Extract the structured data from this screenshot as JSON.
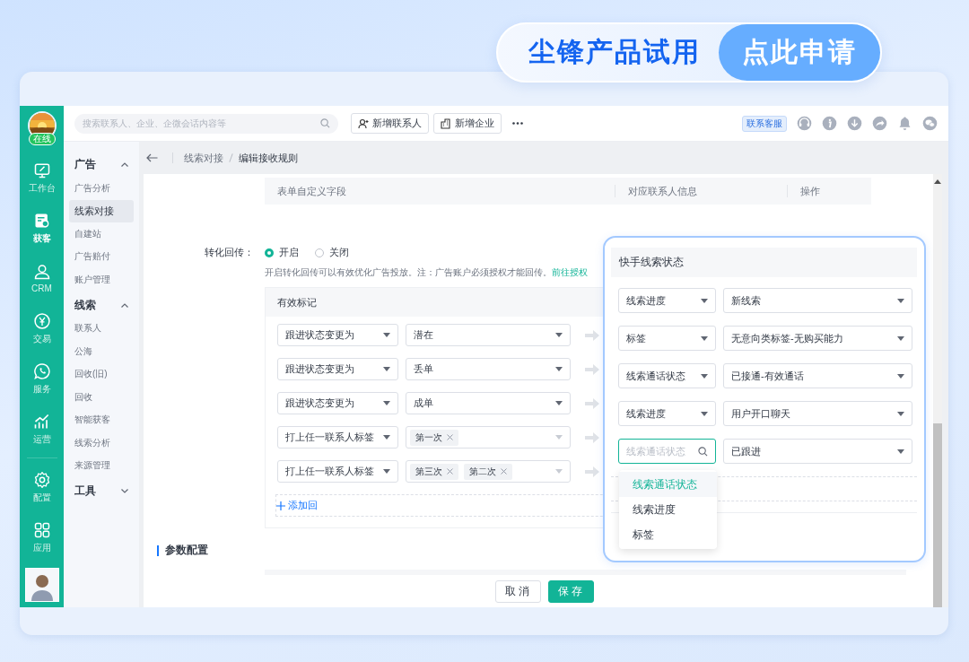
{
  "promo": {
    "title": "尘锋产品试用",
    "button": "点此申请"
  },
  "rail": {
    "status": "在线",
    "items": [
      {
        "label": "工作台",
        "selected": false
      },
      {
        "label": "获客",
        "selected": true
      },
      {
        "label": "CRM",
        "selected": false
      },
      {
        "label": "交易",
        "selected": false
      },
      {
        "label": "服务",
        "selected": false
      },
      {
        "label": "运营",
        "selected": false
      },
      {
        "label": "配置",
        "selected": false
      },
      {
        "label": "应用",
        "selected": false
      }
    ]
  },
  "topbar": {
    "search": {
      "placeholder": "搜索联系人、企业、企微会话内容等"
    },
    "buttons": [
      "新增联系人",
      "新增企业"
    ],
    "support": "联系客服"
  },
  "subnav": {
    "groups": [
      {
        "label": "广告",
        "expanded": true,
        "items": [
          {
            "label": "广告分析",
            "selected": false
          },
          {
            "label": "线索对接",
            "selected": true
          },
          {
            "label": "自建站",
            "selected": false
          },
          {
            "label": "广告赔付",
            "selected": false
          },
          {
            "label": "账户管理",
            "selected": false
          }
        ]
      },
      {
        "label": "线索",
        "expanded": true,
        "items": [
          {
            "label": "联系人",
            "selected": false
          },
          {
            "label": "公海",
            "selected": false
          },
          {
            "label": "回收(旧)",
            "selected": false
          },
          {
            "label": "回收",
            "selected": false
          },
          {
            "label": "智能获客",
            "selected": false
          },
          {
            "label": "线索分析",
            "selected": false
          },
          {
            "label": "来源管理",
            "selected": false
          }
        ]
      },
      {
        "label": "工具",
        "expanded": false
      }
    ]
  },
  "breadcrumb": [
    "线索对接",
    "编辑接收规则"
  ],
  "table": {
    "columns": [
      "表单自定义字段",
      "对应联系人信息",
      "操作"
    ]
  },
  "conversion": {
    "label": "转化回传：",
    "options": [
      {
        "label": "开启",
        "selected": true
      },
      {
        "label": "关闭",
        "selected": false
      }
    ],
    "hint": "开启转化回传可以有效优化广告投放。注：广告账户必须授权才能回传。",
    "link": "前往授权"
  },
  "marks": {
    "title": "有效标记",
    "rows": [
      {
        "kind": "select",
        "condition": "跟进状态变更为",
        "value": "潜在"
      },
      {
        "kind": "select",
        "condition": "跟进状态变更为",
        "value": "丢单"
      },
      {
        "kind": "select",
        "condition": "跟进状态变更为",
        "value": "成单"
      },
      {
        "kind": "tags",
        "condition": "打上任一联系人标签",
        "tags": [
          "第一次"
        ]
      },
      {
        "kind": "tags",
        "condition": "打上任一联系人标签",
        "tags": [
          "第三次",
          "第二次"
        ]
      }
    ],
    "add": "添加回"
  },
  "section": "参数配置",
  "footer": [
    "取消",
    "保存"
  ],
  "callout": {
    "title": "快手线索状态",
    "rows": [
      {
        "kind": "select",
        "field": "线索进度",
        "value": "新线索"
      },
      {
        "kind": "select",
        "field": "标签",
        "value": "无意向类标签-无购买能力"
      },
      {
        "kind": "select",
        "field": "线索通话状态",
        "value": "已接通-有效通话"
      },
      {
        "kind": "select",
        "field": "线索进度",
        "value": "用户开口聊天"
      },
      {
        "kind": "search",
        "placeholder": "线索通话状态",
        "value": "已跟进"
      }
    ],
    "options": [
      {
        "label": "线索通话状态",
        "selected": true
      },
      {
        "label": "线索进度",
        "selected": false
      },
      {
        "label": "标签",
        "selected": false
      }
    ]
  }
}
